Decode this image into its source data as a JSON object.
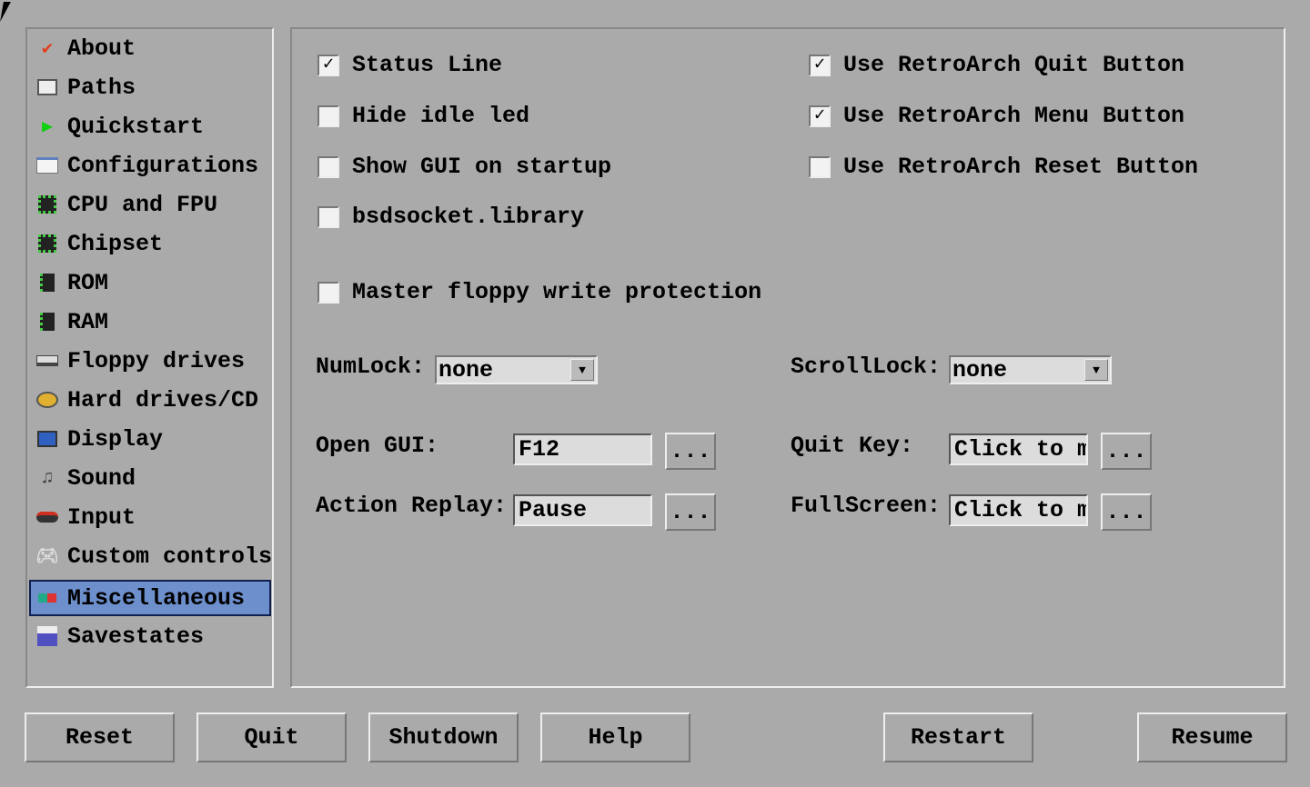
{
  "sidebar": {
    "items": [
      {
        "label": "About",
        "icon": "about-check-icon"
      },
      {
        "label": "Paths",
        "icon": "paths-icon"
      },
      {
        "label": "Quickstart",
        "icon": "play-icon"
      },
      {
        "label": "Configurations",
        "icon": "configurations-icon"
      },
      {
        "label": "CPU and FPU",
        "icon": "chip-icon"
      },
      {
        "label": "Chipset",
        "icon": "chip-icon"
      },
      {
        "label": "ROM",
        "icon": "rom-icon"
      },
      {
        "label": "RAM",
        "icon": "ram-icon"
      },
      {
        "label": "Floppy drives",
        "icon": "floppy-drive-icon"
      },
      {
        "label": "Hard drives/CD",
        "icon": "hard-drive-icon"
      },
      {
        "label": "Display",
        "icon": "display-icon"
      },
      {
        "label": "Sound",
        "icon": "sound-icon"
      },
      {
        "label": "Input",
        "icon": "joystick-icon"
      },
      {
        "label": "Custom controls",
        "icon": "gamepad-icon"
      },
      {
        "label": "Miscellaneous",
        "icon": "misc-icon",
        "selected": true
      },
      {
        "label": "Savestates",
        "icon": "save-icon"
      }
    ],
    "selected_color": "#6d8fcc"
  },
  "options": {
    "status_line": {
      "label": "Status Line",
      "checked": true
    },
    "hide_idle_led": {
      "label": "Hide idle led",
      "checked": false
    },
    "show_gui": {
      "label": "Show GUI on startup",
      "checked": false
    },
    "bsdsocket": {
      "label": "bsdsocket.library",
      "checked": false
    },
    "master_floppy": {
      "label": "Master floppy write protection",
      "checked": false
    },
    "ra_quit": {
      "label": "Use RetroArch Quit Button",
      "checked": true
    },
    "ra_menu": {
      "label": "Use RetroArch Menu Button",
      "checked": true
    },
    "ra_reset": {
      "label": "Use RetroArch Reset Button",
      "checked": false
    }
  },
  "check_glyph": "✓",
  "leds": {
    "numlock_label": "NumLock:",
    "numlock_value": "none",
    "scrolllock_label": "ScrollLock:",
    "scrolllock_value": "none"
  },
  "keys": {
    "open_gui_label": "Open GUI:",
    "open_gui_value": "F12",
    "action_replay_label": "Action Replay:",
    "action_replay_value": "Pause",
    "quit_key_label": "Quit Key:",
    "quit_key_value": "Click to m",
    "fullscreen_label": "FullScreen:",
    "fullscreen_value": "Click to m",
    "browse": "..."
  },
  "buttons": {
    "reset": "Reset",
    "quit": "Quit",
    "shutdown": "Shutdown",
    "help": "Help",
    "restart": "Restart",
    "resume": "Resume"
  }
}
